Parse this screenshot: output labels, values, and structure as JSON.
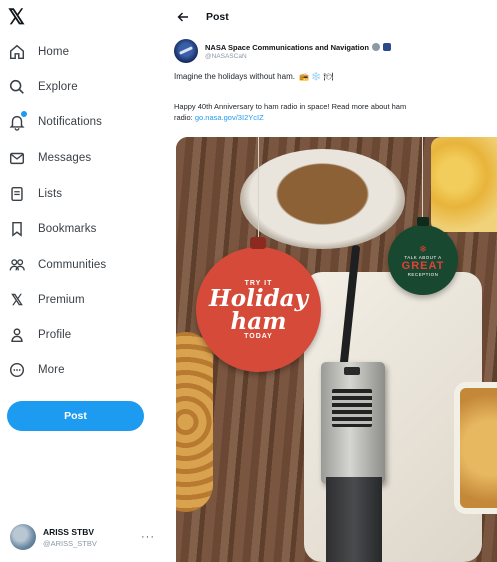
{
  "sidebar": {
    "logo_icon": "x-logo-icon",
    "items": [
      {
        "label": "Home",
        "icon": "home-icon"
      },
      {
        "label": "Explore",
        "icon": "search-icon"
      },
      {
        "label": "Notifications",
        "icon": "bell-icon"
      },
      {
        "label": "Messages",
        "icon": "envelope-icon"
      },
      {
        "label": "Lists",
        "icon": "list-icon"
      },
      {
        "label": "Bookmarks",
        "icon": "bookmark-icon"
      },
      {
        "label": "Communities",
        "icon": "people-icon"
      },
      {
        "label": "Premium",
        "icon": "x-icon"
      },
      {
        "label": "Profile",
        "icon": "person-icon"
      },
      {
        "label": "More",
        "icon": "more-circle-icon"
      }
    ],
    "post_button": "Post",
    "account": {
      "name": "ARISS STBV",
      "handle": "@ARISS_STBV",
      "more": "···"
    }
  },
  "header": {
    "title": "Post",
    "back_icon": "arrow-left-icon"
  },
  "post": {
    "author_name": "NASA Space Communications and Navigation",
    "author_handle": "@NASASCaN",
    "line1": "Imagine the holidays without ham.",
    "line1_emojis": "📻 ❄️ 🍽",
    "line2": "Happy 40th Anniversary to ham radio in space! Read more about ham",
    "line3_prefix": "radio:",
    "link": "go.nasa.gov/3I2YcIZ"
  },
  "media": {
    "ornament_red": {
      "top": "TRY IT",
      "line1": "Holiday",
      "line2": "ham",
      "bottom": "TODAY"
    },
    "ornament_green": {
      "top": "TALK ABOUT A",
      "big": "GREAT",
      "bottom": "RECEPTION",
      "star": "❄"
    }
  },
  "colors": {
    "accent": "#1d9bf0",
    "text": "#0f1419",
    "muted": "#8b98a5",
    "ornament_red": "#d64a3a",
    "ornament_green": "#18482f"
  }
}
